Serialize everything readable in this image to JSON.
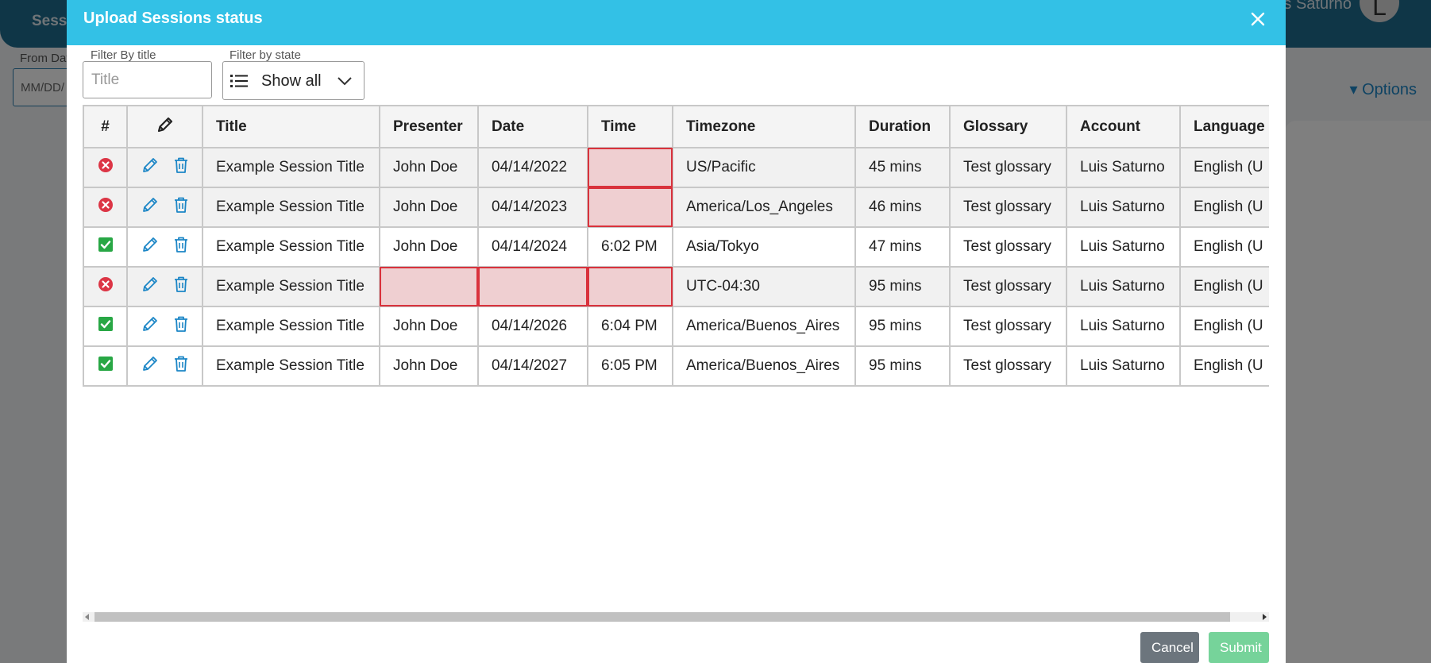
{
  "background": {
    "header_title": "Sessi",
    "user_name": "is Saturno",
    "avatar_initial": "L",
    "from_date_label": "From Dat",
    "from_date_placeholder": "MM/DD/",
    "options_label": "▾ Options"
  },
  "modal": {
    "title": "Upload Sessions status",
    "close_icon": "close-icon",
    "filters": {
      "title_label": "Filter By title",
      "title_placeholder": "Title",
      "title_value": "",
      "state_label": "Filter by state",
      "state_value": "Show all"
    },
    "table": {
      "columns": {
        "index": "#",
        "edit_icon": "pencil-icon",
        "title": "Title",
        "presenter": "Presenter",
        "date": "Date",
        "time": "Time",
        "timezone": "Timezone",
        "duration": "Duration",
        "glossary": "Glossary",
        "account": "Account",
        "language": "Language"
      },
      "rows": [
        {
          "status": "error",
          "title": "Example Session Title",
          "presenter": "John Doe",
          "date": "04/14/2022",
          "time": "",
          "timezone": "US/Pacific",
          "duration": "45 mins",
          "glossary": "Test glossary",
          "account": "Luis Saturno",
          "language": "English (U",
          "invalid": [
            "time"
          ]
        },
        {
          "status": "error",
          "title": "Example Session Title",
          "presenter": "John Doe",
          "date": "04/14/2023",
          "time": "",
          "timezone": "America/Los_Angeles",
          "duration": "46 mins",
          "glossary": "Test glossary",
          "account": "Luis Saturno",
          "language": "English (U",
          "invalid": [
            "time"
          ]
        },
        {
          "status": "ok",
          "title": "Example Session Title",
          "presenter": "John Doe",
          "date": "04/14/2024",
          "time": "6:02 PM",
          "timezone": "Asia/Tokyo",
          "duration": "47 mins",
          "glossary": "Test glossary",
          "account": "Luis Saturno",
          "language": "English (U",
          "invalid": []
        },
        {
          "status": "error",
          "title": "Example Session Title",
          "presenter": "",
          "date": "",
          "time": "",
          "timezone": "UTC-04:30",
          "duration": "95 mins",
          "glossary": "Test glossary",
          "account": "Luis Saturno",
          "language": "English (U",
          "invalid": [
            "presenter",
            "date",
            "time"
          ]
        },
        {
          "status": "ok",
          "title": "Example Session Title",
          "presenter": "John Doe",
          "date": "04/14/2026",
          "time": "6:04 PM",
          "timezone": "America/Buenos_Aires",
          "duration": "95 mins",
          "glossary": "Test glossary",
          "account": "Luis Saturno",
          "language": "English (U",
          "invalid": []
        },
        {
          "status": "ok",
          "title": "Example Session Title",
          "presenter": "John Doe",
          "date": "04/14/2027",
          "time": "6:05 PM",
          "timezone": "America/Buenos_Aires",
          "duration": "95 mins",
          "glossary": "Test glossary",
          "account": "Luis Saturno",
          "language": "English (U",
          "invalid": []
        }
      ]
    },
    "buttons": {
      "cancel": "Cancel",
      "submit": "Submit"
    }
  },
  "colors": {
    "header": "#33c1e6",
    "error": "#dc3545",
    "success": "#28a745",
    "action": "#1c86c6",
    "invalid_cell_bg": "#efcfd1",
    "invalid_cell_border": "#d9323c",
    "submit": "#76d39a",
    "cancel": "#6c757d"
  }
}
